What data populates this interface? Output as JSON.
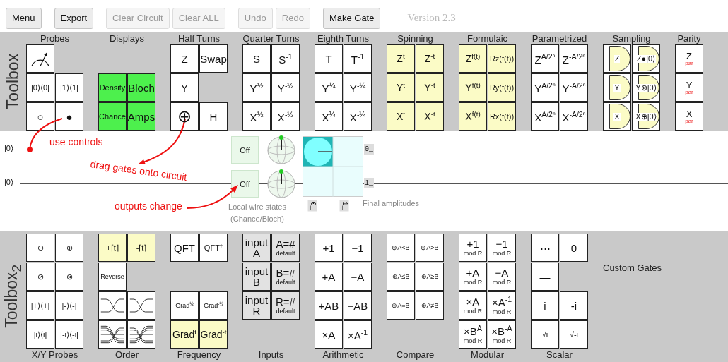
{
  "buttons": [
    {
      "label": "Menu",
      "disabled": false
    },
    {
      "label": "Export",
      "disabled": false
    },
    {
      "label": "Clear Circuit",
      "disabled": true
    },
    {
      "label": "Clear ALL",
      "disabled": true
    },
    {
      "label": "Undo",
      "disabled": true
    },
    {
      "label": "Redo",
      "disabled": true
    },
    {
      "label": "Make Gate",
      "disabled": false
    }
  ],
  "version": "Version 2.3",
  "toolboxes": [
    {
      "title": "Toolbox",
      "groups": [
        {
          "label": "Probes",
          "rows": [
            [
              {
                "kind": "meter"
              },
              {
                "kind": "blank"
              }
            ],
            [
              {
                "kind": "gate",
                "label": "|0⟩⟨0|",
                "small": true
              },
              {
                "kind": "gate",
                "label": "|1⟩⟨1|",
                "small": true
              }
            ],
            [
              {
                "kind": "gate",
                "label": "○"
              },
              {
                "kind": "gate",
                "label": "●"
              }
            ]
          ]
        },
        {
          "label": "Displays",
          "rows": [
            [
              {
                "kind": "blank"
              },
              {
                "kind": "blank"
              }
            ],
            [
              {
                "kind": "display",
                "label": "Density",
                "small": true
              },
              {
                "kind": "display",
                "label": "Bloch"
              }
            ],
            [
              {
                "kind": "display",
                "label": "Chance",
                "small": true
              },
              {
                "kind": "display",
                "label": "Amps"
              }
            ]
          ]
        },
        {
          "label": "Half Turns",
          "rows": [
            [
              {
                "kind": "gate",
                "label": "Z"
              },
              {
                "kind": "gate",
                "label": "Swap"
              }
            ],
            [
              {
                "kind": "gate",
                "label": "Y"
              },
              {
                "kind": "blank"
              }
            ],
            [
              {
                "kind": "gate",
                "label": "⊕",
                "large": true
              },
              {
                "kind": "gate",
                "label": "H"
              }
            ]
          ]
        },
        {
          "label": "Quarter Turns",
          "rows": [
            [
              {
                "kind": "gate",
                "label": "S"
              },
              {
                "kind": "gate",
                "label": "S$^{-1}$"
              }
            ],
            [
              {
                "kind": "gate",
                "label": "Y$^{½}$"
              },
              {
                "kind": "gate",
                "label": "Y$^{-½}$"
              }
            ],
            [
              {
                "kind": "gate",
                "label": "X$^{½}$"
              },
              {
                "kind": "gate",
                "label": "X$^{-½}$"
              }
            ]
          ]
        },
        {
          "label": "Eighth Turns",
          "rows": [
            [
              {
                "kind": "gate",
                "label": "T"
              },
              {
                "kind": "gate",
                "label": "T$^{-1}$"
              }
            ],
            [
              {
                "kind": "gate",
                "label": "Y$^{¼}$"
              },
              {
                "kind": "gate",
                "label": "Y$^{-¼}$"
              }
            ],
            [
              {
                "kind": "gate",
                "label": "X$^{¼}$"
              },
              {
                "kind": "gate",
                "label": "X$^{-¼}$"
              }
            ]
          ]
        },
        {
          "label": "Spinning",
          "rows": [
            [
              {
                "kind": "timed",
                "label": "Z$^{t}$"
              },
              {
                "kind": "timed",
                "label": "Z$^{-t}$"
              }
            ],
            [
              {
                "kind": "timed",
                "label": "Y$^{t}$"
              },
              {
                "kind": "timed",
                "label": "Y$^{-t}$"
              }
            ],
            [
              {
                "kind": "timed",
                "label": "X$^{t}$"
              },
              {
                "kind": "timed",
                "label": "X$^{-t}$"
              }
            ]
          ]
        },
        {
          "label": "Formulaic",
          "rows": [
            [
              {
                "kind": "timed",
                "label": "Z$^{f(t)}$"
              },
              {
                "kind": "timed",
                "label": "Rz(f(t))",
                "small": true
              }
            ],
            [
              {
                "kind": "timed",
                "label": "Y$^{f(t)}$"
              },
              {
                "kind": "timed",
                "label": "Ry(f(t))",
                "small": true
              }
            ],
            [
              {
                "kind": "timed",
                "label": "X$^{f(t)}$"
              },
              {
                "kind": "timed",
                "label": "Rx(f(t))",
                "small": true
              }
            ]
          ]
        },
        {
          "label": "Parametrized",
          "rows": [
            [
              {
                "kind": "gate",
                "label": "Z$^{A/2ⁿ}$"
              },
              {
                "kind": "gate",
                "label": "Z$^{-A/2ⁿ}$"
              }
            ],
            [
              {
                "kind": "gate",
                "label": "Y$^{A/2ⁿ}$"
              },
              {
                "kind": "gate",
                "label": "Y$^{-A/2ⁿ}$"
              }
            ],
            [
              {
                "kind": "gate",
                "label": "X$^{A/2ⁿ}$"
              },
              {
                "kind": "gate",
                "label": "X$^{-A/2ⁿ}$"
              }
            ]
          ]
        },
        {
          "label": "Sampling",
          "rows": [
            [
              {
                "kind": "sample",
                "label": "Z",
                "small": true
              },
              {
                "kind": "sample",
                "label": "Z●|0⟩",
                "small": true
              }
            ],
            [
              {
                "kind": "sample",
                "label": "Y",
                "small": true
              },
              {
                "kind": "sample",
                "label": "Y⊗|0⟩",
                "small": true
              }
            ],
            [
              {
                "kind": "sample",
                "label": "X",
                "small": true
              },
              {
                "kind": "sample",
                "label": "X⊕|0⟩",
                "small": true
              }
            ]
          ]
        },
        {
          "label": "Parity",
          "rows": [
            [
              {
                "kind": "parity",
                "label": "Z",
                "sub": "par"
              }
            ],
            [
              {
                "kind": "parity",
                "label": "Y",
                "sub": "par"
              }
            ],
            [
              {
                "kind": "parity",
                "label": "X",
                "sub": "par"
              }
            ]
          ]
        }
      ]
    },
    {
      "title": "Toolbox$_{2}$",
      "groups": [
        {
          "label": "X/Y Probes",
          "rows": [
            [
              {
                "kind": "gate",
                "label": "⊖",
                "small": true
              },
              {
                "kind": "gate",
                "label": "⊕",
                "small": true
              }
            ],
            [
              {
                "kind": "gate",
                "label": "⊘",
                "small": true
              },
              {
                "kind": "gate",
                "label": "⊗",
                "small": true
              }
            ],
            [
              {
                "kind": "gate",
                "label": "|+⟩⟨+|",
                "small": true
              },
              {
                "kind": "gate",
                "label": "|-⟩⟨-|",
                "small": true
              }
            ],
            [
              {
                "kind": "gate",
                "label": "|i⟩⟨i|",
                "small": true
              },
              {
                "kind": "gate",
                "label": "|-i⟩⟨-i|",
                "small": true
              }
            ]
          ]
        },
        {
          "label": "Order",
          "rows": [
            [
              {
                "kind": "timed",
                "label": "+⌈t⌉",
                "small": true
              },
              {
                "kind": "timed",
                "label": "-⌈t⌉",
                "small": true
              }
            ],
            [
              {
                "kind": "gate",
                "label": "Reverse",
                "tiny": true
              },
              {
                "kind": "blank"
              }
            ],
            [
              {
                "kind": "cross"
              },
              {
                "kind": "cross-flip"
              }
            ],
            [
              {
                "kind": "multi-cross"
              },
              {
                "kind": "multi-cross-flip"
              }
            ]
          ]
        },
        {
          "label": "Frequency",
          "rows": [
            [
              {
                "kind": "gate",
                "label": "QFT"
              },
              {
                "kind": "gate",
                "label": "QFT$^{†}$",
                "small": true
              }
            ],
            [
              {
                "kind": "blank"
              },
              {
                "kind": "blank"
              }
            ],
            [
              {
                "kind": "gate",
                "label": "Grad$^{½}$",
                "tiny": true
              },
              {
                "kind": "gate",
                "label": "Grad$^{-½}$",
                "tiny": true
              }
            ],
            [
              {
                "kind": "timed",
                "label": "Grad$^{t}$"
              },
              {
                "kind": "timed",
                "label": "Grad$^{-t}$"
              }
            ]
          ]
        },
        {
          "label": "Inputs",
          "rows": [
            [
              {
                "kind": "input",
                "label": "input A"
              },
              {
                "kind": "input",
                "label": "A=#",
                "sub": "default"
              }
            ],
            [
              {
                "kind": "input",
                "label": "input B"
              },
              {
                "kind": "input",
                "label": "B=#",
                "sub": "default"
              }
            ],
            [
              {
                "kind": "input",
                "label": "input R"
              },
              {
                "kind": "input",
                "label": "R=#",
                "sub": "default"
              }
            ],
            [
              {
                "kind": "blank"
              },
              {
                "kind": "blank"
              }
            ]
          ]
        },
        {
          "label": "Arithmetic",
          "rows": [
            [
              {
                "kind": "gate",
                "label": "+1"
              },
              {
                "kind": "gate",
                "label": "−1"
              }
            ],
            [
              {
                "kind": "gate",
                "label": "+A"
              },
              {
                "kind": "gate",
                "label": "−A"
              }
            ],
            [
              {
                "kind": "gate",
                "label": "+AB"
              },
              {
                "kind": "gate",
                "label": "−AB"
              }
            ],
            [
              {
                "kind": "gate",
                "label": "×A"
              },
              {
                "kind": "gate",
                "label": "×A$^{-1}$"
              }
            ]
          ]
        },
        {
          "label": "Compare",
          "rows": [
            [
              {
                "kind": "gate",
                "label": "⊕A<B",
                "tiny": true
              },
              {
                "kind": "gate",
                "label": "⊕A>B",
                "tiny": true
              }
            ],
            [
              {
                "kind": "gate",
                "label": "⊕A≤B",
                "tiny": true
              },
              {
                "kind": "gate",
                "label": "⊕A≥B",
                "tiny": true
              }
            ],
            [
              {
                "kind": "gate",
                "label": "⊕A=B",
                "tiny": true
              },
              {
                "kind": "gate",
                "label": "⊕A≠B",
                "tiny": true
              }
            ],
            [
              {
                "kind": "blank"
              },
              {
                "kind": "blank"
              }
            ]
          ]
        },
        {
          "label": "Modular",
          "rows": [
            [
              {
                "kind": "gate",
                "label": "+1",
                "sub": "mod R"
              },
              {
                "kind": "gate",
                "label": "−1",
                "sub": "mod R"
              }
            ],
            [
              {
                "kind": "gate",
                "label": "+A",
                "sub": "mod R"
              },
              {
                "kind": "gate",
                "label": "−A",
                "sub": "mod R"
              }
            ],
            [
              {
                "kind": "gate",
                "label": "×A",
                "sub": "mod R"
              },
              {
                "kind": "gate",
                "label": "×A$^{-1}$",
                "sub": "mod R"
              }
            ],
            [
              {
                "kind": "gate",
                "label": "×B$^{A}$",
                "sub": "mod R"
              },
              {
                "kind": "gate",
                "label": "×B$^{-A}$",
                "sub": "mod R"
              }
            ]
          ]
        },
        {
          "label": "Scalar",
          "rows": [
            [
              {
                "kind": "gate",
                "label": "⋯"
              },
              {
                "kind": "gate",
                "label": "0"
              }
            ],
            [
              {
                "kind": "gate",
                "label": "—"
              },
              {
                "kind": "blank"
              }
            ],
            [
              {
                "kind": "gate",
                "label": "i"
              },
              {
                "kind": "gate",
                "label": "-i"
              }
            ],
            [
              {
                "kind": "gate",
                "label": "√i",
                "small": true
              },
              {
                "kind": "gate",
                "label": "√-i",
                "small": true
              }
            ]
          ]
        },
        {
          "label": "Custom Gates",
          "rows": [
            [
              {
                "kind": "blank"
              },
              {
                "kind": "blank"
              }
            ]
          ]
        }
      ]
    }
  ],
  "circuit": {
    "wires": [
      {
        "input": "|0⟩",
        "chance": "Off",
        "output": "0_"
      },
      {
        "input": "|0⟩",
        "chance": "Off",
        "output": "1_"
      }
    ],
    "local_states_label": "Local wire states (Chance/Bloch)",
    "column_labels": [
      "0_",
      "1_"
    ],
    "amplitudes_label": "Final amplitudes"
  },
  "annotations": [
    {
      "text": "use controls"
    },
    {
      "text": "drag gates onto circuit"
    },
    {
      "text": "outputs change"
    }
  ]
}
